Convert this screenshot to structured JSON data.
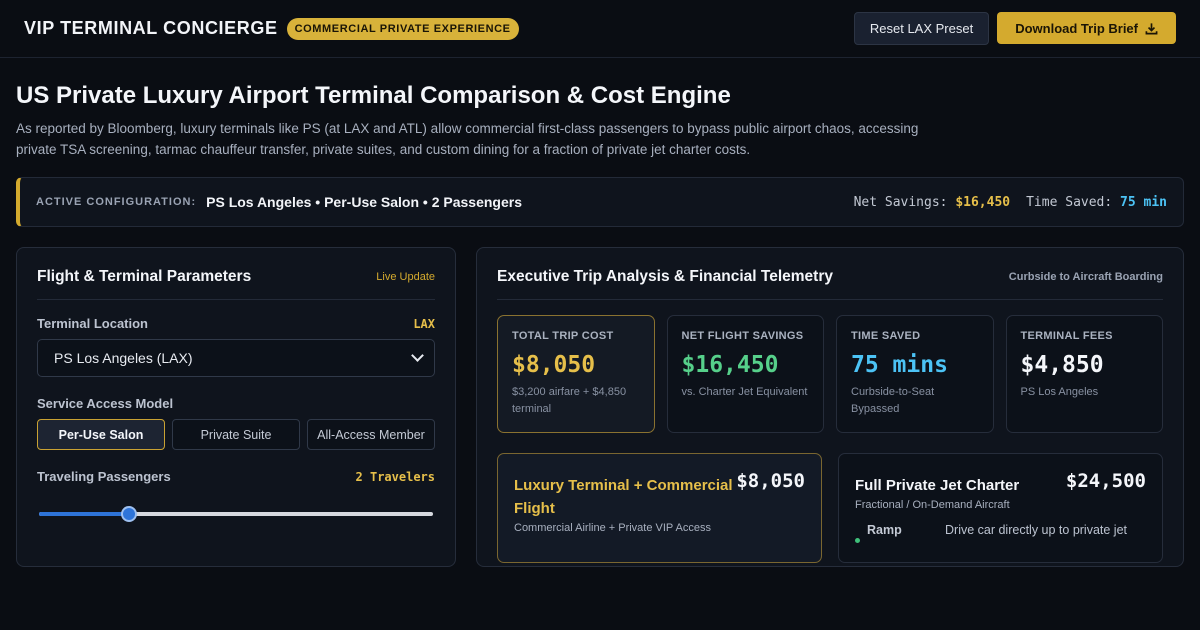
{
  "header": {
    "brand": "VIP TERMINAL CONCIERGE",
    "badge": "COMMERCIAL PRIVATE EXPERIENCE",
    "reset_label": "Reset LAX Preset",
    "download_label": "Download Trip Brief",
    "download_icon": "download-icon"
  },
  "hero": {
    "title": "US Private Luxury Airport Terminal Comparison & Cost Engine",
    "description": "As reported by Bloomberg, luxury terminals like PS (at LAX and ATL) allow commercial first-class passengers to bypass public airport chaos, accessing private TSA screening, tarmac chauffeur transfer, private suites, and custom dining for a fraction of private jet charter costs."
  },
  "config": {
    "label": "ACTIVE CONFIGURATION:",
    "value": "PS Los Angeles • Per-Use Salon • 2 Passengers",
    "savings_label": "Net Savings:",
    "savings_value": "$16,450",
    "time_label": "Time Saved:",
    "time_value": "75 min"
  },
  "params": {
    "title": "Flight & Terminal Parameters",
    "live": "Live Update",
    "location_label": "Terminal Location",
    "location_code": "LAX",
    "location_value": "PS Los Angeles (LAX)",
    "access_label": "Service Access Model",
    "access_options": [
      "Per-Use Salon",
      "Private Suite",
      "All-Access Member"
    ],
    "access_selected": "Per-Use Salon",
    "passengers_label": "Traveling Passengers",
    "passengers_value": "2 Travelers",
    "passengers_slider_fraction": 0.22
  },
  "analysis": {
    "title": "Executive Trip Analysis & Financial Telemetry",
    "subtitle": "Curbside to Aircraft Boarding",
    "metrics": [
      {
        "label": "TOTAL TRIP COST",
        "value": "$8,050",
        "note": "$3,200 airfare + $4,850 terminal",
        "color": "#e6bf4a"
      },
      {
        "label": "NET FLIGHT SAVINGS",
        "value": "$16,450",
        "note": "vs. Charter Jet Equivalent",
        "color": "#56d08a"
      },
      {
        "label": "TIME SAVED",
        "value": "75 mins",
        "note": "Curbside-to-Seat Bypassed",
        "color": "#4cc3f5"
      },
      {
        "label": "TERMINAL FEES",
        "value": "$4,850",
        "note": "PS Los Angeles",
        "color": "#f4f6fa"
      }
    ],
    "compare": [
      {
        "title": "Luxury Terminal + Commercial Flight",
        "price": "$8,050",
        "sub": "Commercial Airline + Private VIP Access"
      },
      {
        "title": "Full Private Jet Charter",
        "price": "$24,500",
        "sub": "Fractional / On-Demand Aircraft",
        "row_key": "Ramp",
        "row_val": "Drive car directly up to private jet"
      }
    ]
  }
}
